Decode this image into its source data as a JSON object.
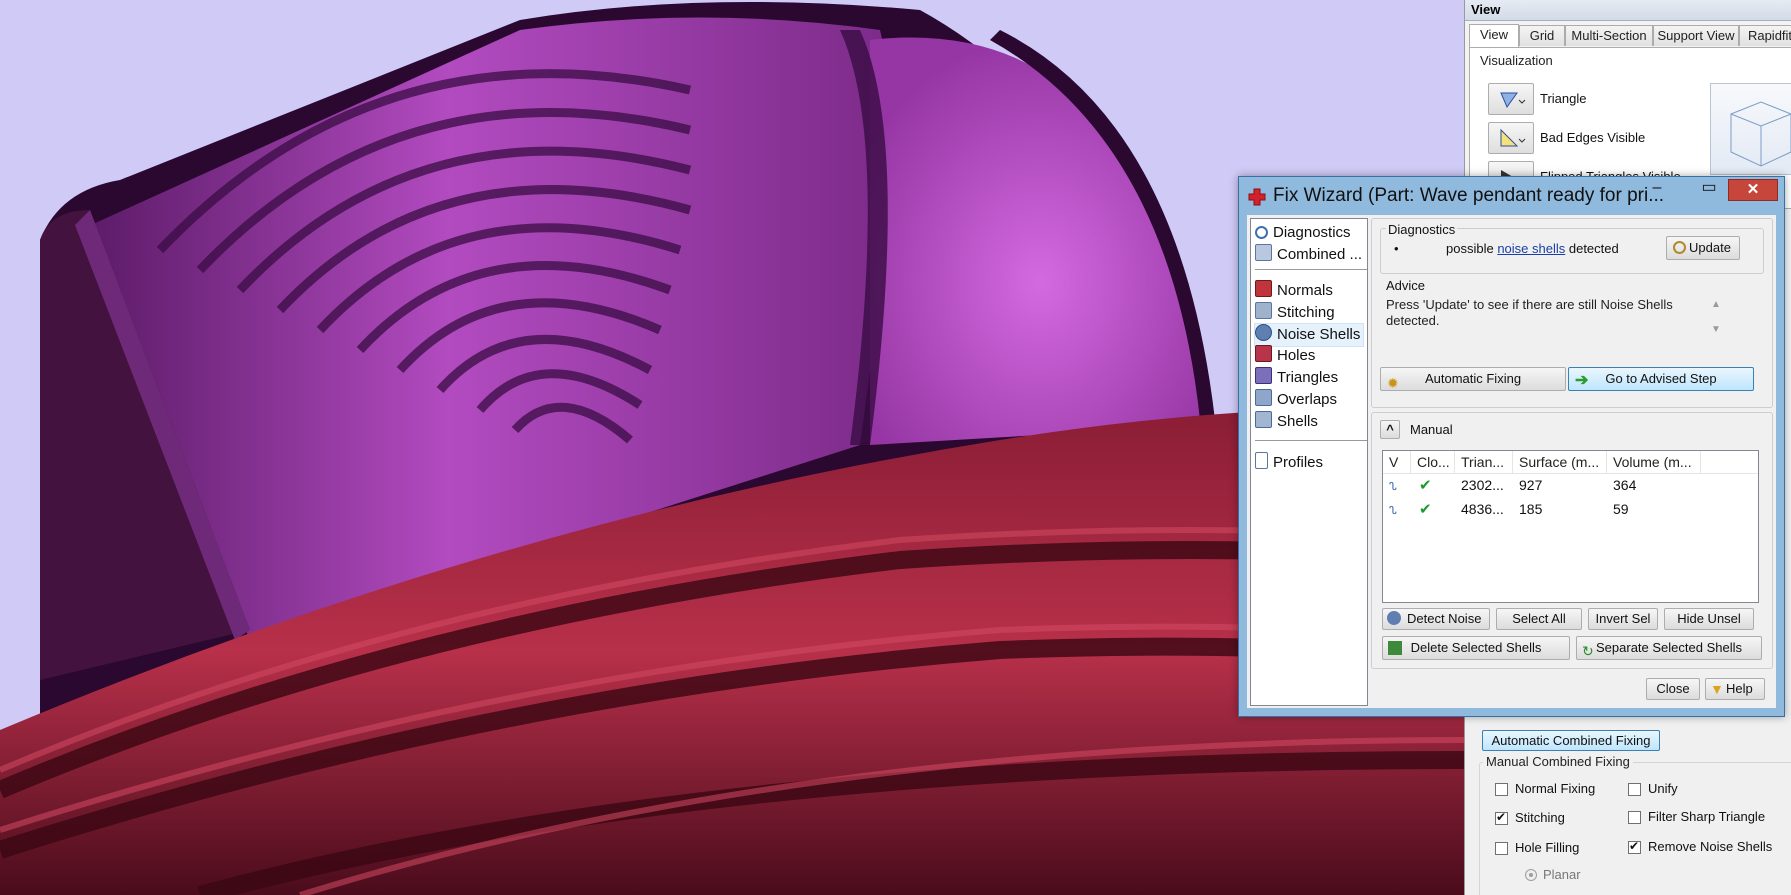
{
  "view_panel": {
    "title": "View",
    "tabs": [
      "View",
      "Grid",
      "Multi-Section",
      "Support View",
      "Rapidfit"
    ],
    "visualization_label": "Visualization",
    "vis_items": [
      "Triangle",
      "Bad Edges Visible",
      "Flipped Triangles Visible"
    ],
    "automatic_combined_fixing": "Automatic Combined Fixing",
    "manual_combined_fixing": "Manual Combined Fixing",
    "options": [
      {
        "label": "Normal Fixing",
        "checked": false
      },
      {
        "label": "Unify",
        "checked": false
      },
      {
        "label": "Stitching",
        "checked": true
      },
      {
        "label": "Filter Sharp Triangle",
        "checked": false
      },
      {
        "label": "Hole Filling",
        "checked": false
      },
      {
        "label": "Remove Noise Shells",
        "checked": true
      }
    ],
    "hole_fill_mode": "Planar"
  },
  "fix_wizard": {
    "title": "Fix Wizard (Part: Wave pendant ready for pri...",
    "minimize": "–",
    "maximize": "▭",
    "close": "✕",
    "nav_top": [
      "Diagnostics",
      "Combined ..."
    ],
    "nav_mid": [
      "Normals",
      "Stitching",
      "Noise Shells",
      "Holes",
      "Triangles",
      "Overlaps",
      "Shells"
    ],
    "nav_bottom": [
      "Profiles"
    ],
    "selected_nav": "Noise Shells",
    "diagnostics": {
      "label": "Diagnostics",
      "bullet": "•",
      "text_pre": "possible ",
      "text_link": "noise shells",
      "text_post": " detected",
      "update_button": "Update"
    },
    "advice": {
      "label": "Advice",
      "text": "Press 'Update' to see if there are still Noise Shells detected."
    },
    "automatic_fixing": "Automatic Fixing",
    "go_to_advised_step": "Go to Advised Step",
    "manual": {
      "collapse_glyph": "^",
      "label": "Manual",
      "columns": [
        "V",
        "Clo...",
        "Trian...",
        "Surface (m...",
        "Volume (m..."
      ],
      "rows": [
        {
          "triangles": "2302...",
          "surface": "927",
          "volume": "364"
        },
        {
          "triangles": "4836...",
          "surface": "185",
          "volume": "59"
        }
      ],
      "detect_noise": "Detect Noise",
      "select_all": "Select All",
      "invert_sel": "Invert Sel",
      "hide_unsel": "Hide Unsel",
      "delete_selected": "Delete Selected Shells",
      "separate_selected": "Separate Selected Shells"
    },
    "close_button": "Close",
    "help_button": "Help"
  },
  "colors": {
    "viewport_bg": "#cfcaf6",
    "mesh_purple": "#9a3aa6",
    "mesh_red": "#a0203a",
    "dialog_frame": "#8fb9dd",
    "close_red": "#c7463c"
  }
}
